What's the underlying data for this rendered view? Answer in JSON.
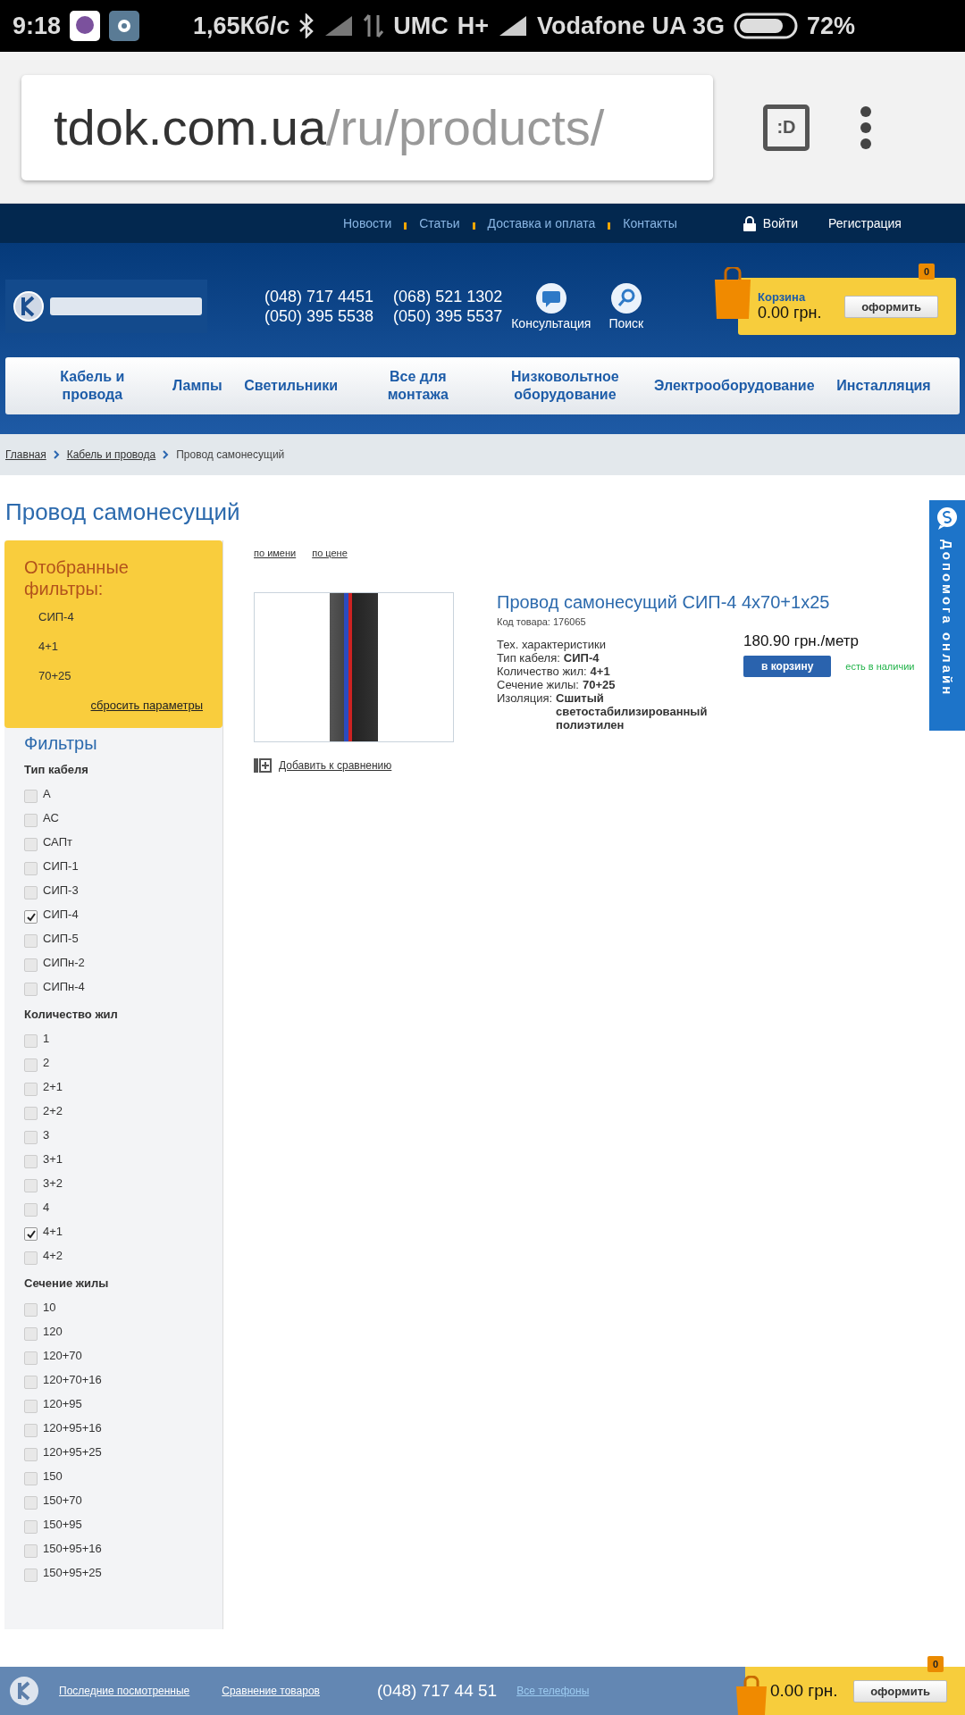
{
  "status_bar": {
    "time": "9:18",
    "speed": "1,65Кб/с",
    "carrier_1": "UMC",
    "network": "H+",
    "carrier_2": "Vodafone UA 3G",
    "battery": "72%"
  },
  "browser": {
    "url_host": "tdok.com.ua",
    "url_path": "/ru/products/",
    "tab_icon": ":D"
  },
  "top_nav": [
    "Новости",
    "Статьи",
    "Доставка и оплата",
    "Контакты"
  ],
  "account": {
    "login": "Войти",
    "register": "Регистрация"
  },
  "header": {
    "phones": [
      "(048) 717 4451",
      "(068) 521 1302",
      "(050) 395 5538",
      "(050) 395 5537"
    ],
    "consult": "Консультация",
    "search": "Поиск",
    "cart": {
      "count": "0",
      "label": "Корзина",
      "total": "0.00 грн.",
      "checkout": "оформить"
    }
  },
  "menu": [
    "Кабель и провода",
    "Лампы",
    "Светильники",
    "Все для монтажа",
    "Низковольтное оборудование",
    "Электрооборудование",
    "Инсталляция"
  ],
  "breadcrumbs": [
    "Главная",
    "Кабель и провода",
    "Провод самонесущий"
  ],
  "page_title": "Провод самонесущий",
  "selected_filters": {
    "title": "Отобранные фильтры:",
    "items": [
      "СИП-4",
      "4+1",
      "70+25"
    ],
    "reset": "сбросить параметры"
  },
  "filters": {
    "title": "Фильтры",
    "groups": [
      {
        "name": "Тип кабеля",
        "options": [
          {
            "label": "А",
            "checked": false
          },
          {
            "label": "АС",
            "checked": false
          },
          {
            "label": "САПт",
            "checked": false
          },
          {
            "label": "СИП-1",
            "checked": false
          },
          {
            "label": "СИП-3",
            "checked": false
          },
          {
            "label": "СИП-4",
            "checked": true
          },
          {
            "label": "СИП-5",
            "checked": false
          },
          {
            "label": "СИПн-2",
            "checked": false
          },
          {
            "label": "СИПн-4",
            "checked": false
          }
        ]
      },
      {
        "name": "Количество жил",
        "options": [
          {
            "label": "1",
            "checked": false
          },
          {
            "label": "2",
            "checked": false
          },
          {
            "label": "2+1",
            "checked": false
          },
          {
            "label": "2+2",
            "checked": false
          },
          {
            "label": "3",
            "checked": false
          },
          {
            "label": "3+1",
            "checked": false
          },
          {
            "label": "3+2",
            "checked": false
          },
          {
            "label": "4",
            "checked": false
          },
          {
            "label": "4+1",
            "checked": true
          },
          {
            "label": "4+2",
            "checked": false
          }
        ]
      },
      {
        "name": "Сечение жилы",
        "options": [
          {
            "label": "10",
            "checked": false
          },
          {
            "label": "120",
            "checked": false
          },
          {
            "label": "120+70",
            "checked": false
          },
          {
            "label": "120+70+16",
            "checked": false
          },
          {
            "label": "120+95",
            "checked": false
          },
          {
            "label": "120+95+16",
            "checked": false
          },
          {
            "label": "120+95+25",
            "checked": false
          },
          {
            "label": "150",
            "checked": false
          },
          {
            "label": "150+70",
            "checked": false
          },
          {
            "label": "150+95",
            "checked": false
          },
          {
            "label": "150+95+16",
            "checked": false
          },
          {
            "label": "150+95+25",
            "checked": false
          }
        ]
      }
    ]
  },
  "sort": [
    "по имени",
    "по цене"
  ],
  "product": {
    "title": "Провод самонесущий СИП-4 4x70+1x25",
    "code": "Код товара: 176065",
    "specs_title": "Тех. характеристики",
    "specs": [
      {
        "label": "Тип кабеля:",
        "value": "СИП-4"
      },
      {
        "label": "Количество жил:",
        "value": "4+1"
      },
      {
        "label": "Сечение жилы:",
        "value": "70+25"
      },
      {
        "label": "Изоляция:",
        "value": "Сшитый светостабилизированный полиэтилен"
      }
    ],
    "price": "180.90 грн./метр",
    "buy": "в корзину",
    "availability": "есть в наличии",
    "compare": "Добавить к сравнению"
  },
  "help_tab": "Допомога онлайн",
  "bottom_bar": {
    "recent": "Последние посмотренные",
    "compare": "Сравнение товаров",
    "phone": "(048) 717 44 51",
    "all_phones": "Все телефоны",
    "cart_count": "0",
    "total": "0.00 грн.",
    "checkout": "оформить"
  }
}
